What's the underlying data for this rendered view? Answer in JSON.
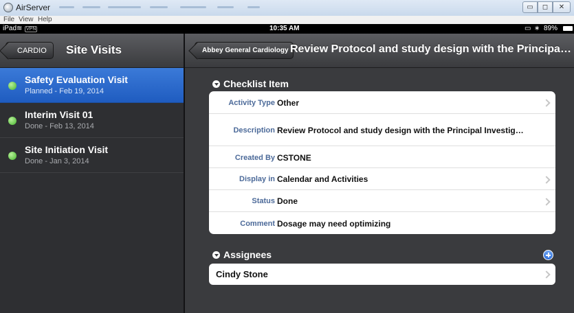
{
  "window": {
    "app_title": "AirServer",
    "menu": [
      "File",
      "View",
      "Help"
    ],
    "controls": {
      "minimize": "▭",
      "maximize": "◻",
      "close": "✕"
    }
  },
  "status_bar": {
    "device": "iPad",
    "vpn": "VPN",
    "time": "10:35 AM",
    "battery": "89%"
  },
  "master": {
    "back_label": "CARDIO",
    "title": "Site Visits",
    "visits": [
      {
        "title": "Safety Evaluation Visit",
        "subtitle": "Planned - Feb 19, 2014",
        "selected": true,
        "status_color": "#45b52d"
      },
      {
        "title": "Interim Visit 01",
        "subtitle": "Done - Feb 13, 2014",
        "selected": false,
        "status_color": "#45b52d"
      },
      {
        "title": "Site Initiation Visit",
        "subtitle": "Done - Jan 3, 2014",
        "selected": false,
        "status_color": "#45b52d"
      }
    ]
  },
  "detail": {
    "back_label": "Abbey General Cardiology",
    "title": "Review Protocol and study design with the Principa…",
    "checklist": {
      "heading": "Checklist Item",
      "fields": [
        {
          "label": "Activity Type",
          "value": "Other",
          "chevron": true
        },
        {
          "label": "Description",
          "value": "Review Protocol and study design with the Principal Investig…",
          "chevron": false
        },
        {
          "label": "Created By",
          "value": "CSTONE",
          "chevron": false
        },
        {
          "label": "Display in",
          "value": "Calendar and Activities",
          "chevron": true
        },
        {
          "label": "Status",
          "value": "Done",
          "chevron": true
        },
        {
          "label": "Comment",
          "value": "Dosage may need optimizing",
          "chevron": false
        }
      ]
    },
    "assignees": {
      "heading": "Assignees",
      "items": [
        "Cindy Stone"
      ]
    }
  },
  "colors": {
    "selection": "#2a68cc",
    "label_blue": "#4c6a99",
    "status_green": "#45b52d"
  }
}
